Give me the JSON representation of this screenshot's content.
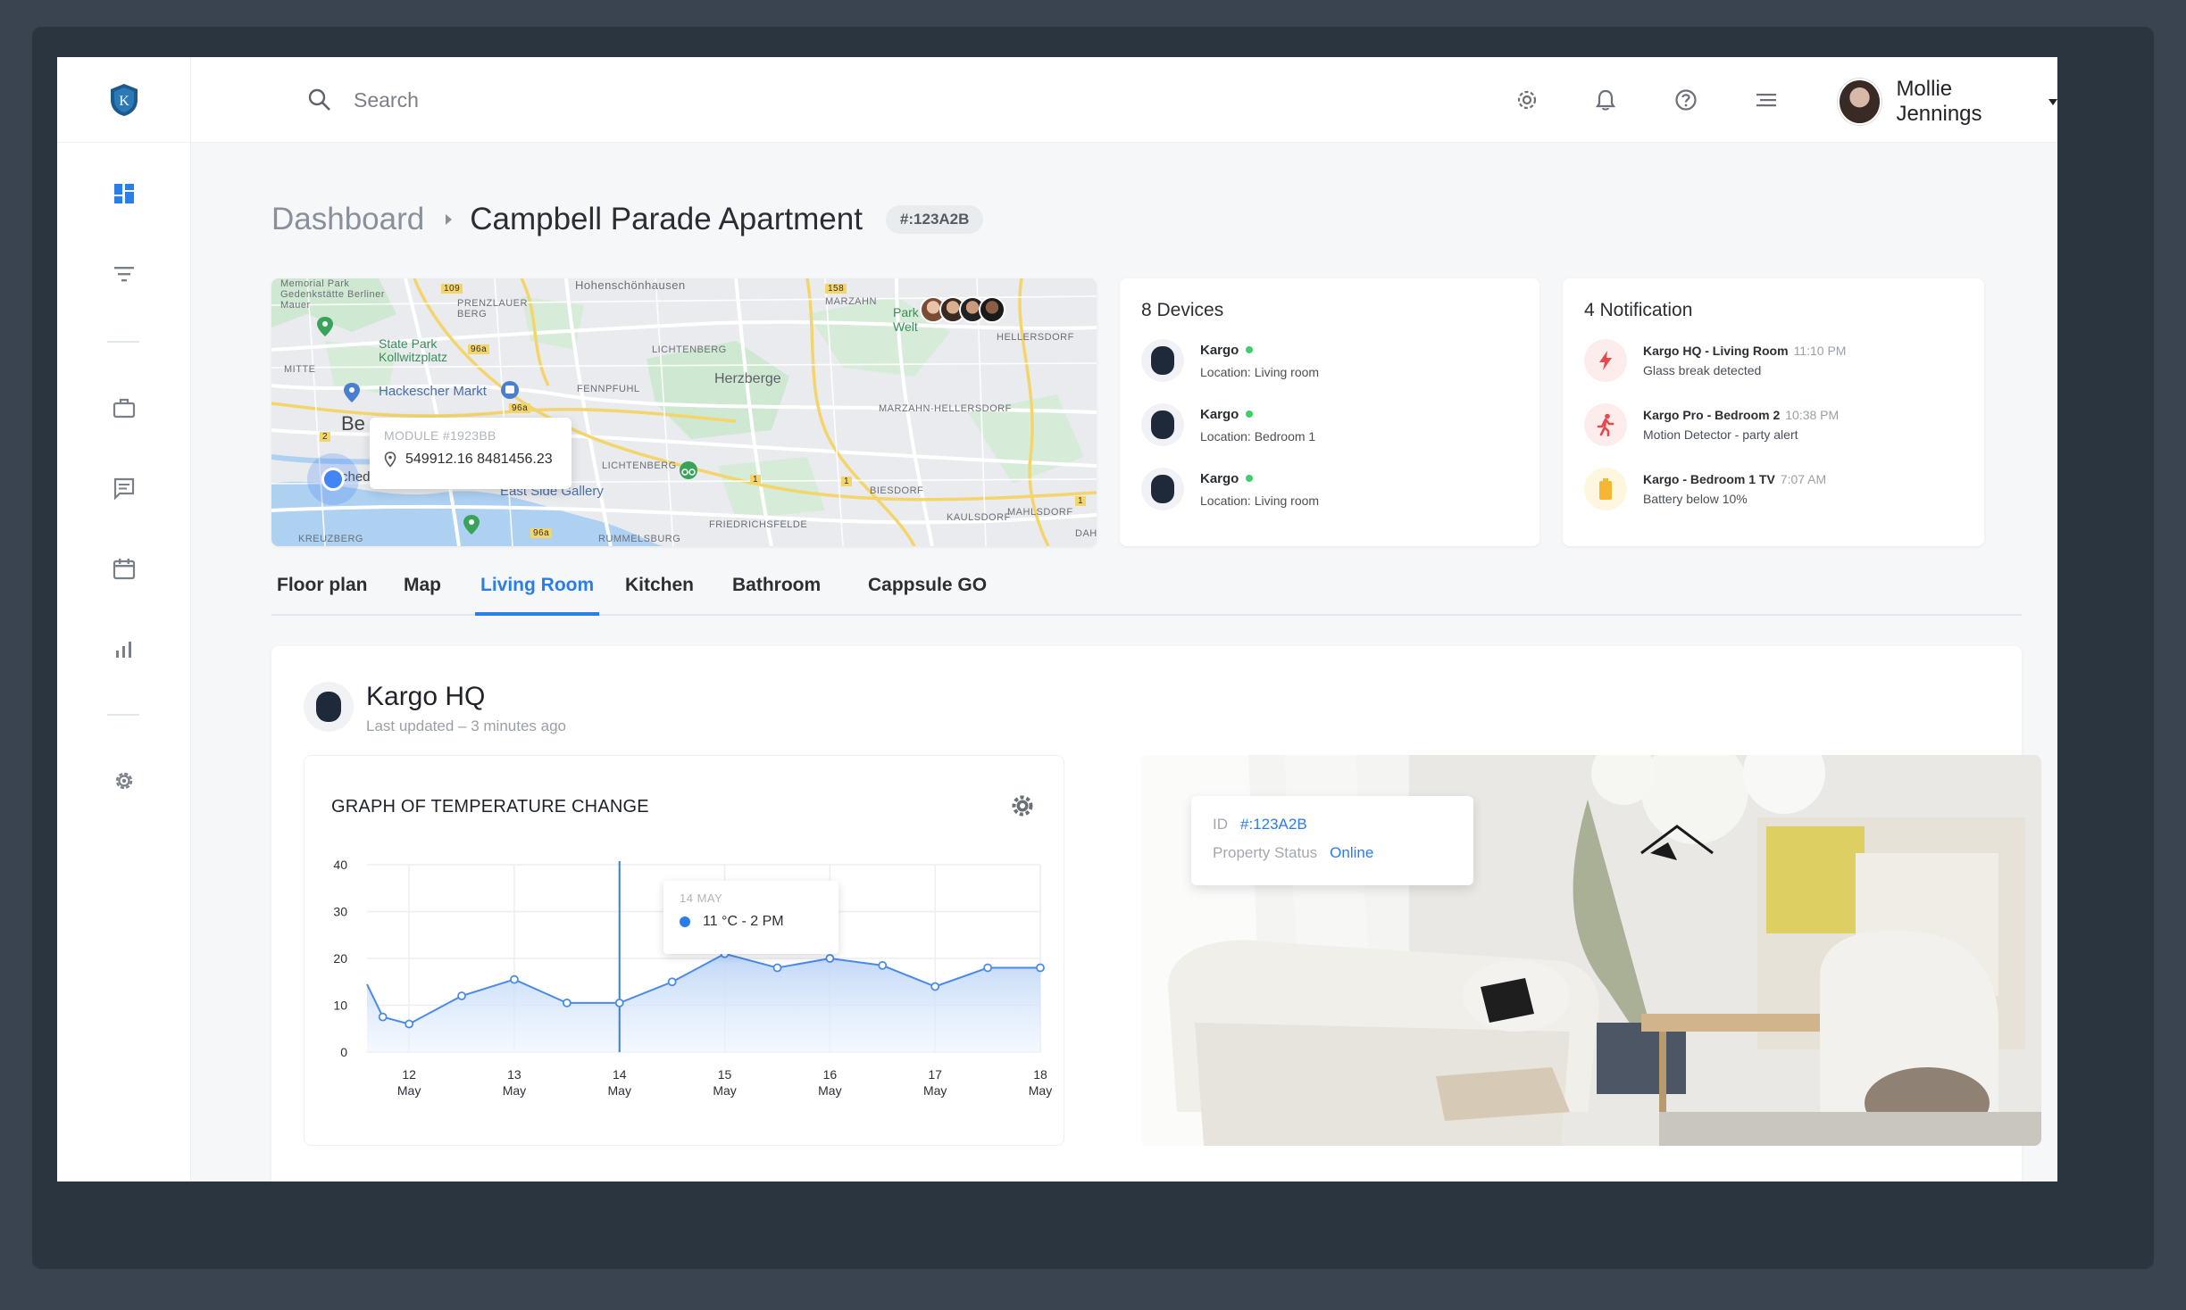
{
  "user": {
    "name": "Mollie Jennings"
  },
  "search": {
    "placeholder": "Search"
  },
  "breadcrumb": {
    "root": "Dashboard",
    "current": "Campbell Parade Apartment",
    "badge": "#:123A2B"
  },
  "map": {
    "labels": {
      "memorial": "Memorial Park Gedenkstätte Berliner Mauer",
      "hohen": "Hohenschönhausen",
      "prenz": "PRENZLAUER BERG",
      "marzahn": "MARZAHN",
      "state_park": "State Park Kollwitzplatz",
      "lichtenberg": "LICHTENBERG",
      "hellersdorf": "HELLERSDORF",
      "mitte": "MITTE",
      "hackescher": "Hackescher Markt",
      "fennpfuhl": "FENNPFUHL",
      "herzberge": "Herzberge",
      "marzahn_hellersdorf": "MARZAHN-HELLERSDORF",
      "park": "Park der Welt",
      "lichtenberg2": "LICHTENBERG",
      "biesdorf": "BIESDORF",
      "east_side": "East Side Gallery",
      "friedrichsfelde": "FRIEDRICHSFELDE",
      "kaulsdorf": "KAULSDORF",
      "mahlsdorf": "MAHLSDORF",
      "kreuzberg": "KREUZBERG",
      "rummelsburg": "RUMMELSBURG",
      "be": "Be",
      "ched": "ched",
      "dah": "DAH",
      "road_109": "109",
      "road_158": "158",
      "road_96a_1": "96a",
      "road_96a_2": "96a",
      "road_96a_3": "96a",
      "road_1_a": "1",
      "road_1_b": "1",
      "road_1_c": "1",
      "road_2": "2"
    },
    "tooltip": {
      "module": "MODULE #1923BB",
      "coords": "549912.16 8481456.23"
    }
  },
  "devices": {
    "title": "8 Devices",
    "items": [
      {
        "name": "Kargo",
        "location": "Location: Living room"
      },
      {
        "name": "Kargo",
        "location": "Location: Bedroom 1"
      },
      {
        "name": "Kargo",
        "location": "Location: Living room"
      }
    ]
  },
  "notifications": {
    "title": "4 Notification",
    "items": [
      {
        "title": "Kargo HQ - Living Room",
        "time": "11:10 PM",
        "desc": "Glass break detected",
        "icon": "lightning-icon",
        "color": "#e5484d"
      },
      {
        "title": "Kargo Pro - Bedroom 2",
        "time": "10:38 PM",
        "desc": "Motion Detector - party alert",
        "icon": "running-person-icon",
        "color": "#e5484d"
      },
      {
        "title": "Kargo - Bedroom 1 TV",
        "time": "7:07 AM",
        "desc": "Battery below 10%",
        "icon": "battery-icon",
        "color": "#f5b731"
      }
    ]
  },
  "tabs": [
    "Floor plan",
    "Map",
    "Living Room",
    "Kitchen",
    "Bathroom",
    "Cappsule GO"
  ],
  "active_tab": "Living Room",
  "device_panel": {
    "title": "Kargo HQ",
    "subtitle": "Last updated – 3 minutes ago",
    "graph_title": "GRAPH OF TEMPERATURE CHANGE",
    "tooltip": {
      "date": "14 MAY",
      "value": "11 °C - 2 PM"
    },
    "property": {
      "id_label": "ID",
      "id_value": "#:123A2B",
      "status_label": "Property Status",
      "status_value": "Online"
    }
  },
  "colors": {
    "accent": "#2b7de9",
    "online": "#3ecf6a",
    "alert": "#e5484d",
    "warning": "#f5b731"
  },
  "chart_data": {
    "type": "area",
    "title": "GRAPH OF TEMPERATURE CHANGE",
    "xlabel": "",
    "ylabel": "",
    "ylim": [
      0,
      40
    ],
    "yticks": [
      0,
      10,
      20,
      30,
      40
    ],
    "x_tick_labels": [
      {
        "day": "12",
        "month": "May"
      },
      {
        "day": "13",
        "month": "May"
      },
      {
        "day": "14",
        "month": "May"
      },
      {
        "day": "15",
        "month": "May"
      },
      {
        "day": "16",
        "month": "May"
      },
      {
        "day": "17",
        "month": "May"
      },
      {
        "day": "18",
        "month": "May"
      }
    ],
    "x": [
      11.6,
      11.75,
      12,
      12.5,
      13,
      13.5,
      14,
      14.5,
      15,
      15.5,
      16,
      16.5,
      17,
      17.5,
      18
    ],
    "values": [
      14.5,
      7.5,
      6,
      12,
      15.5,
      10.5,
      10.5,
      15,
      21,
      18,
      20,
      18.5,
      14,
      18,
      18
    ],
    "highlight": {
      "x": 14,
      "value": 11
    },
    "grid": true
  }
}
